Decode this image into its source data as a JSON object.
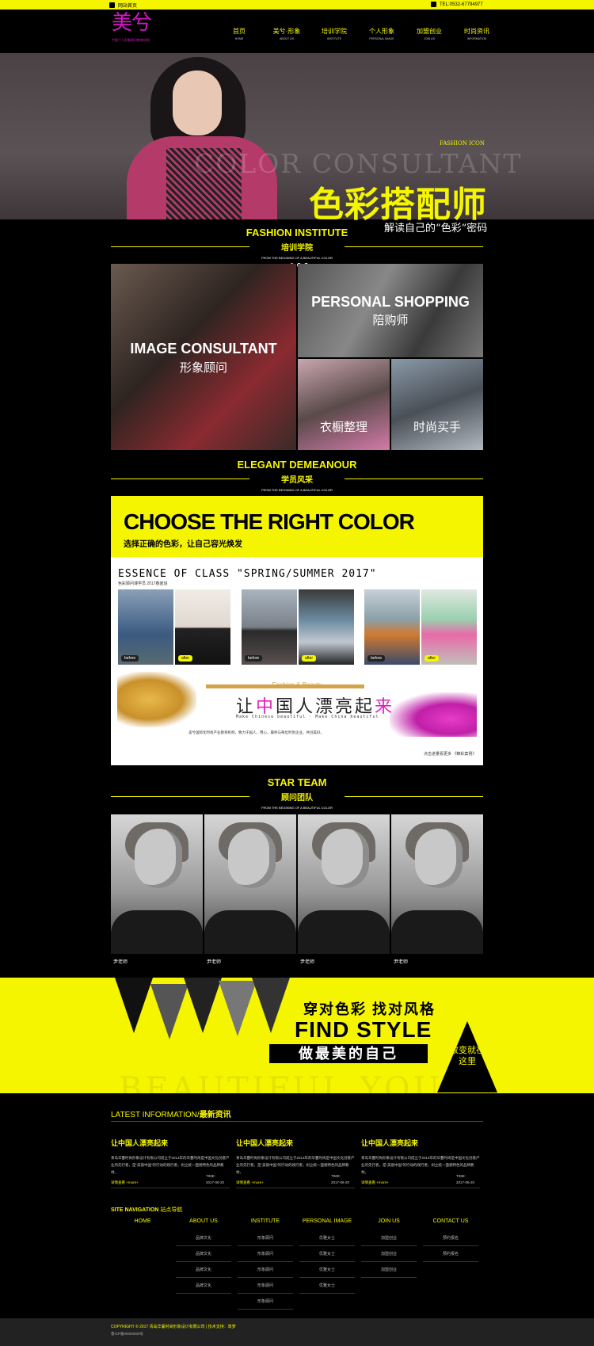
{
  "topbar": {
    "home_link": "网站首页",
    "home_sub": "HOME",
    "phone": "TEL:0532-67794977"
  },
  "logo": {
    "text": "美兮",
    "small": "中国个人形象顾问教育机构"
  },
  "nav": [
    {
      "cn": "首页",
      "en": "HOME"
    },
    {
      "cn": "美兮·形象",
      "en": "ABOUT US"
    },
    {
      "cn": "培训学院",
      "en": "INSTITUTE"
    },
    {
      "cn": "个人形象",
      "en": "PERSONAL IMAGE"
    },
    {
      "cn": "加盟创业",
      "en": "JOIN US"
    },
    {
      "cn": "时尚资讯",
      "en": "INFORMATION"
    }
  ],
  "hero": {
    "tag": "FASHION ICON",
    "bg_text": "COLOR CONSULTANT",
    "title": "色彩搭配师",
    "subtitle": "解读自己的“色彩”密码"
  },
  "institute": {
    "en": "FASHION INSTITUTE",
    "cn": "培训学院",
    "tiny": "FROM THE BEGINING OF A BEAUTIFUL COLOR"
  },
  "tiles": {
    "image": {
      "en": "IMAGE CONSULTANT",
      "cn": "形象顾问"
    },
    "shopping": {
      "en": "PERSONAL SHOPPING",
      "cn": "陪购师"
    },
    "wardrobe": {
      "cn": "衣橱整理"
    },
    "fashion": {
      "cn": "时尚买手"
    }
  },
  "demeanour": {
    "en": "ELEGANT DEMEANOUR",
    "cn": "学员风采",
    "tiny": "FROM THE BEGINING OF A BEAUTIFUL COLOR"
  },
  "banner": {
    "headline": "CHOOSE THE RIGHT COLOR",
    "sub": "选择正确的色彩，让自己容光焕发",
    "essence": "ESSENCE OF CLASS \"SPRING/SUMMER 2017\"",
    "essence_sub": "色彩顾问课学员 2017春夏班",
    "before": "before",
    "after": "after",
    "fb": "Fashion & Beauty",
    "slogan_a": "让",
    "slogan_m1": "中",
    "slogan_b": "国人漂亮起",
    "slogan_m2": "来",
    "make": "Make Chinese beautiful · Make China beautiful",
    "desc": "美兮国际化时尚产业教育机构，致力于国人，用心，最终与每位时尚企业，共创美好。",
    "caption": "点击进量看更多 《精彩案例》"
  },
  "star": {
    "en": "STAR TEAM",
    "cn": "顾问团队",
    "tiny": "FROM THE BEGINING OF A BEAUTIFUL COLOR"
  },
  "team": [
    {
      "name": "尹老师"
    },
    {
      "name": "尹老师"
    },
    {
      "name": "尹老师"
    },
    {
      "name": "尹老师"
    }
  ],
  "promo": {
    "line1": "穿对色彩 找对风格",
    "line2": "FIND STYLE",
    "line3": "做最美的自己",
    "tri": "改变就在这里",
    "bg": "BEAUTIFUL YOU"
  },
  "news": {
    "heading_en": "LATEST INFORMATION/",
    "heading_cn": "最新资讯",
    "items": [
      {
        "title": "让中国人漂亮起来",
        "body": "青岛华蔓时尚形象设计有限公司成立于2013年的华蔓时尚是中国文化创意产业的先行者，是“美丽中国”的行动的践行者，树立统一面貌特色的品牌教材。",
        "time_label": "TIME:",
        "time": "2017-06-20",
        "more": "详情查看 +more+"
      },
      {
        "title": "让中国人漂亮起来",
        "body": "青岛华蔓时尚形象设计有限公司成立于2013年的华蔓时尚是中国文化创意产业的先行者，是“美丽中国”的行动的践行者，树立统一面貌特色的品牌教材。",
        "time_label": "TIME:",
        "time": "2017-06-20",
        "more": "详情查看 +more+"
      },
      {
        "title": "让中国人漂亮起来",
        "body": "青岛华蔓时尚形象设计有限公司成立于2013年的华蔓时尚是中国文化创意产业的先行者，是“美丽中国”的行动的践行者，树立统一面貌特色的品牌教材。",
        "time_label": "TIME:",
        "time": "2017-06-20",
        "more": "详情查看 +more+"
      }
    ]
  },
  "sitenav": {
    "heading_en": "SITE NAVIGATION",
    "heading_cn": "站点导航",
    "cols": [
      {
        "h": "HOME",
        "links": []
      },
      {
        "h": "ABOUT US",
        "links": [
          "品牌文化",
          "品牌文化",
          "品牌文化",
          "品牌文化"
        ]
      },
      {
        "h": "INSTITUTE",
        "links": [
          "形象顾问",
          "形象顾问",
          "形象顾问",
          "形象顾问",
          "形象顾问"
        ]
      },
      {
        "h": "PERSONAL IMAGE",
        "links": [
          "优雅女士",
          "优雅女士",
          "优雅女士",
          "优雅女士"
        ]
      },
      {
        "h": "JOIN US",
        "links": [
          "加盟创业",
          "加盟创业",
          "加盟创业"
        ]
      },
      {
        "h": "CONTACT US",
        "links": [
          "预约报名",
          "预约报名"
        ]
      }
    ]
  },
  "footer": {
    "copy": "COPYRIGHT © 2017  青岛华蔓时尚形象设计有限公司 | 技术支持：筑梦",
    "icp": "鲁ICP备00000000号"
  }
}
